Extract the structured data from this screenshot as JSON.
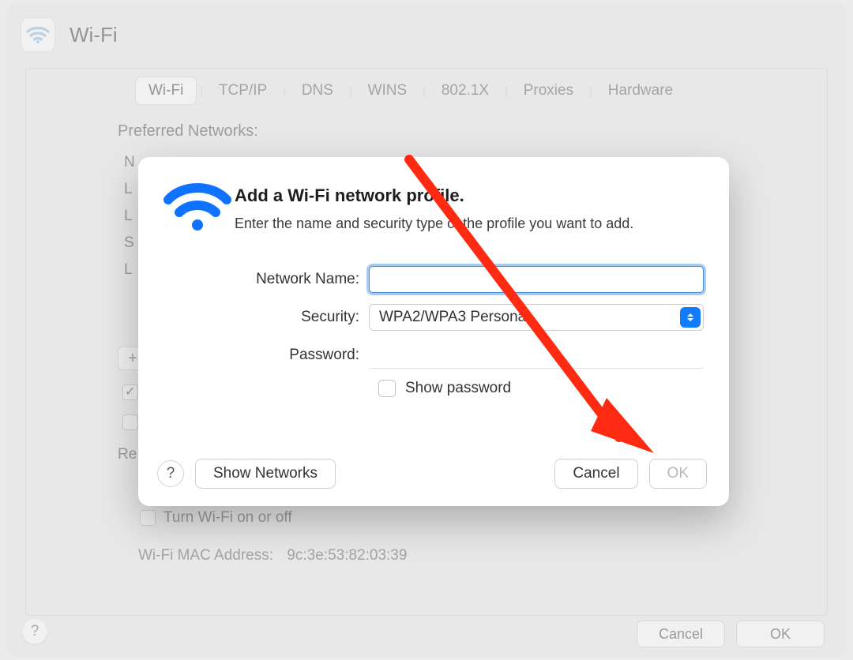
{
  "header": {
    "title": "Wi-Fi"
  },
  "tabs": {
    "items": [
      "Wi-Fi",
      "TCP/IP",
      "DNS",
      "WINS",
      "802.1X",
      "Proxies",
      "Hardware"
    ],
    "selected": 0
  },
  "sectionLabel": "Preferred Networks:",
  "networkList": {
    "headerCol": "N",
    "rows": [
      "L",
      "L",
      "S",
      "L"
    ]
  },
  "plusLabel": "+",
  "checkRows": {
    "first_checked": true,
    "second_checked": false,
    "secondLabel": "Re"
  },
  "turnWifiLabel": "Turn Wi-Fi on or off",
  "mac": {
    "label": "Wi-Fi MAC Address:",
    "value": "9c:3e:53:82:03:39"
  },
  "footer": {
    "cancel": "Cancel",
    "ok": "OK"
  },
  "helpGlyph": "?",
  "dialog": {
    "title": "Add a Wi-Fi network profile.",
    "subtitle": "Enter the name and security type of the profile you want to add.",
    "networkNameLabel": "Network Name:",
    "networkNameValue": "",
    "securityLabel": "Security:",
    "securityValue": "WPA2/WPA3 Personal",
    "passwordLabel": "Password:",
    "passwordValue": "",
    "showPwdLabel": "Show password",
    "showPwdChecked": false,
    "showNetworks": "Show Networks",
    "cancel": "Cancel",
    "ok": "OK"
  }
}
